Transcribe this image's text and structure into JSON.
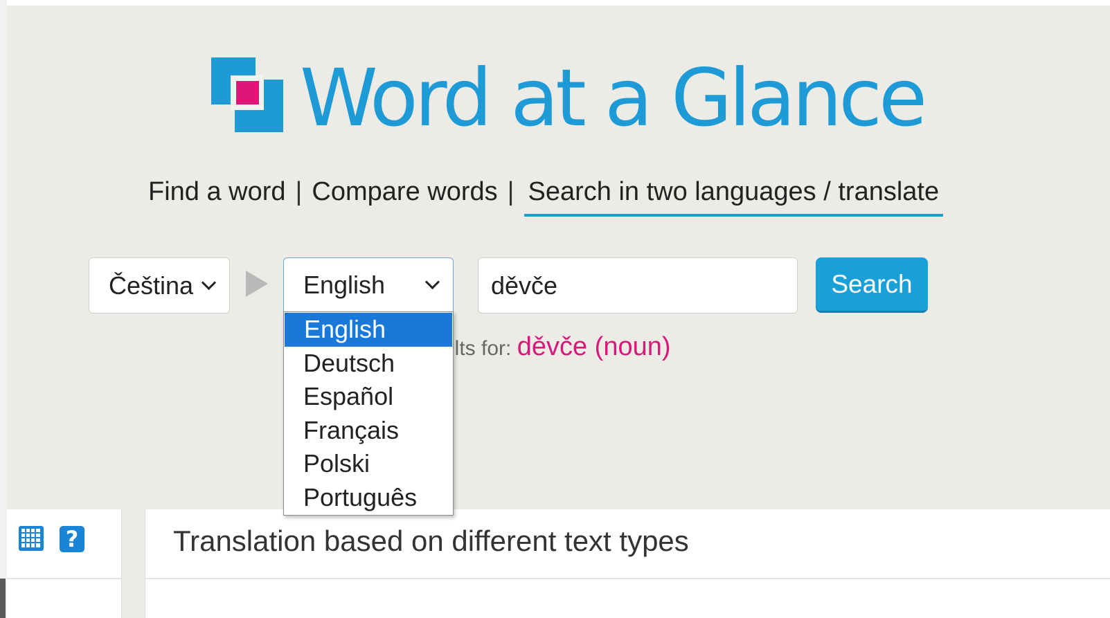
{
  "app": {
    "title": "Word at a Glance",
    "accent_color": "#1e9bd7",
    "highlight_color": "#d6197a"
  },
  "nav": {
    "items": [
      "Find a word",
      "Compare words",
      "Search in two languages / translate"
    ],
    "separator": "|",
    "active_index": 2
  },
  "search": {
    "source_language": "Čeština",
    "target_language": "English",
    "query": "děvče",
    "button_label": "Search"
  },
  "dropdown": {
    "options": [
      "English",
      "Deutsch",
      "Español",
      "Français",
      "Polski",
      "Português"
    ],
    "selected_index": 0
  },
  "results": {
    "visible_prefix": "ults for:",
    "term": "děvče (noun)"
  },
  "panel": {
    "icons": [
      "grid-icon",
      "help-icon"
    ],
    "help_glyph": "?",
    "title": "Translation based on different text types"
  }
}
